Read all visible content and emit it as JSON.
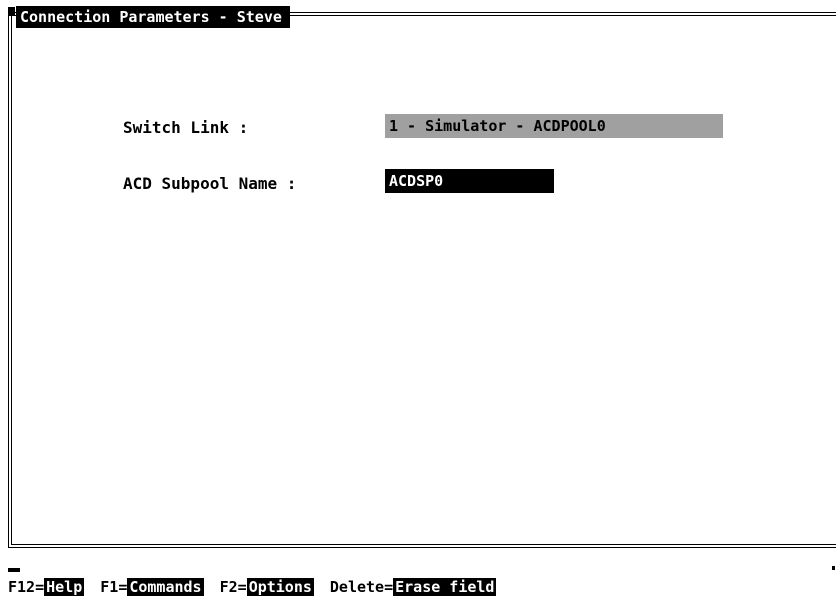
{
  "window": {
    "title": "Connection Parameters - Steve"
  },
  "form": {
    "switch_link": {
      "label": "Switch Link :",
      "value": "1 - Simulator - ACDPOOL0"
    },
    "acd_subpool": {
      "label": "ACD Subpool Name :",
      "value": "ACDSP0"
    }
  },
  "function_keys": [
    {
      "key": "F12",
      "action": "Help"
    },
    {
      "key": "F1",
      "action": "Commands"
    },
    {
      "key": "F2",
      "action": "Options"
    },
    {
      "key": "Delete",
      "action": "Erase field"
    }
  ],
  "colors": {
    "background": "#ffffff",
    "foreground": "#000000",
    "selected_field": "#a0a0a0",
    "active_field": "#000000"
  }
}
